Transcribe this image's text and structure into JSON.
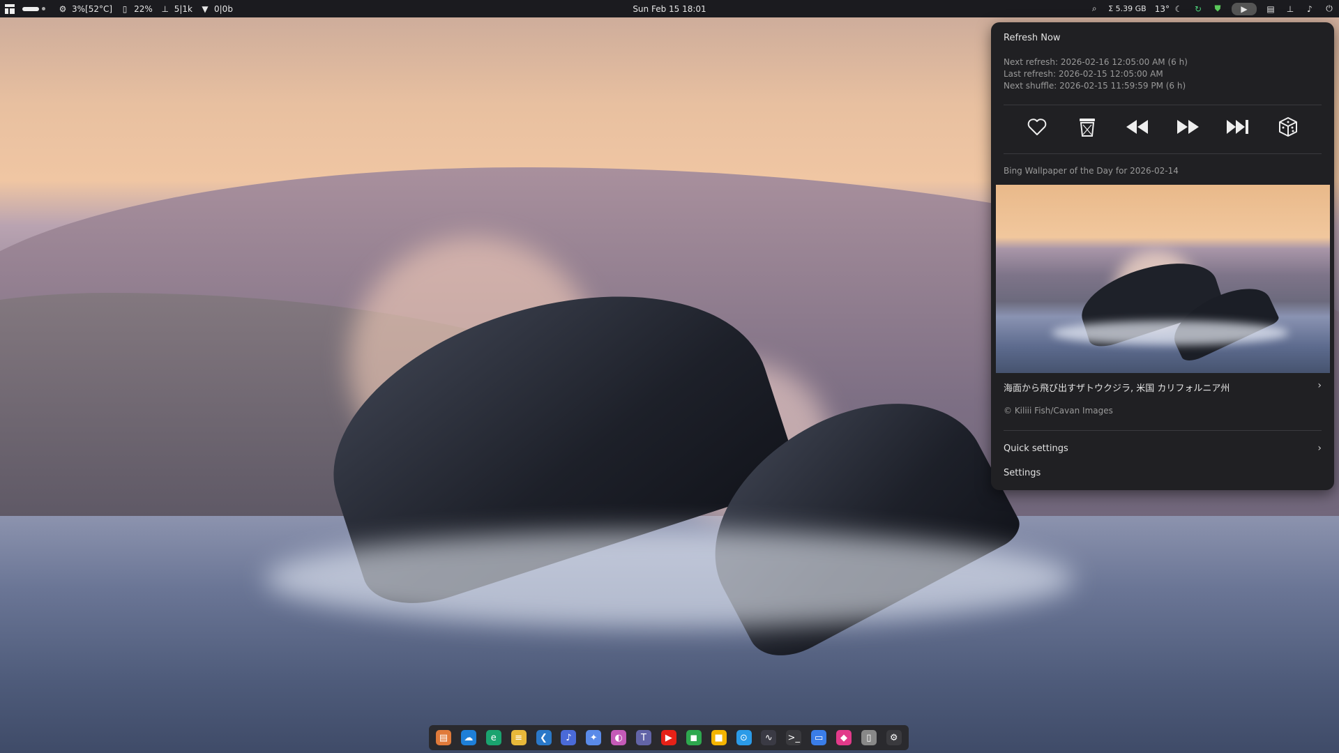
{
  "topbar": {
    "cpu": "3%[52°C]",
    "memory": "22%",
    "network_rate": "5|1k",
    "wifi_rate": "0|0b",
    "clock": "Sun Feb 15  18:01",
    "storage": "Σ 5.39 GB",
    "weather": "13°",
    "icons": [
      "apps-icon",
      "workspace-indicator-icon",
      "cpu-icon",
      "memory-icon",
      "network-icon",
      "wifi-icon",
      "search-icon",
      "weather-icon",
      "update-icon",
      "shield-icon",
      "bing-wallpaper-icon",
      "clipboard-icon",
      "network-tray-icon",
      "volume-icon",
      "power-icon"
    ]
  },
  "popup": {
    "refresh_now": "Refresh Now",
    "next_refresh": "Next refresh: 2026-02-16 12:05:00 AM (6 h)",
    "last_refresh": "Last refresh: 2026-02-15 12:05:00 AM",
    "next_shuffle": "Next shuffle: 2026-02-15 11:59:59 PM (6 h)",
    "controls": [
      "favorite-icon",
      "trash-icon",
      "previous-icon",
      "next-icon",
      "latest-icon",
      "random-icon"
    ],
    "caption": "Bing Wallpaper of the Day for 2026-02-14",
    "description": "海面から飛び出すザトウクジラ, 米国 カリフォルニア州",
    "copyright": "© Kiliii Fish/Cavan Images",
    "quick_settings": "Quick settings",
    "settings": "Settings"
  },
  "dock": {
    "apps": [
      {
        "name": "files-app",
        "glyph": "▤",
        "color": "#e07a3a"
      },
      {
        "name": "onedrive-app",
        "glyph": "☁",
        "color": "#1e7fd8"
      },
      {
        "name": "edge-app",
        "glyph": "e",
        "color": "#1aa36f"
      },
      {
        "name": "notes-app",
        "glyph": "≡",
        "color": "#e8b83a"
      },
      {
        "name": "vscode-app",
        "glyph": "❮",
        "color": "#2a78c8"
      },
      {
        "name": "voice-app",
        "glyph": "♪",
        "color": "#4a6ad8"
      },
      {
        "name": "gemini-app",
        "glyph": "✦",
        "color": "#5a8ae8"
      },
      {
        "name": "copilot-app",
        "glyph": "◐",
        "color": "#c45ab8"
      },
      {
        "name": "teams-app",
        "glyph": "T",
        "color": "#6264a7"
      },
      {
        "name": "youtube-app",
        "glyph": "▶",
        "color": "#e62117"
      },
      {
        "name": "chat-app",
        "glyph": "◼",
        "color": "#2ea84e"
      },
      {
        "name": "meet-app",
        "glyph": "■",
        "color": "#f4b400"
      },
      {
        "name": "browser-app",
        "glyph": "⊙",
        "color": "#2b9be8"
      },
      {
        "name": "monitor-app",
        "glyph": "∿",
        "color": "#3a3a44"
      },
      {
        "name": "terminal-app",
        "glyph": ">_",
        "color": "#3a3a3e"
      },
      {
        "name": "messages-app",
        "glyph": "▭",
        "color": "#3a7de8"
      },
      {
        "name": "pdf-app",
        "glyph": "◆",
        "color": "#e23a8a"
      },
      {
        "name": "trash-app",
        "glyph": "▯",
        "color": "#888888"
      },
      {
        "name": "settings-app",
        "glyph": "⚙",
        "color": "#3a3a3e"
      }
    ]
  }
}
